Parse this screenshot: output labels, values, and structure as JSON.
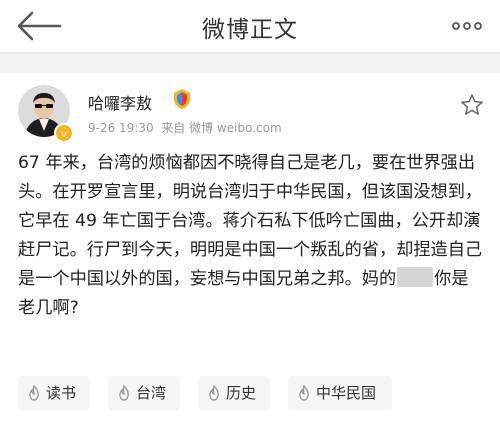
{
  "header": {
    "title": "微博正文",
    "back_icon": "back-arrow-icon",
    "more_icon": "more-dots-icon"
  },
  "post": {
    "username": "哈囉李敖",
    "time": "9-26 19:30",
    "source": "来自 微博 weibo.com",
    "content_before": "67 年来，台湾的烦恼都因不晓得自己是老几，要在世界强出头。在开罗宣言里，明说台湾归于中华民国，但该国没想到，它早在 49 年亡国于台湾。蒋介石私下低吟亡国曲，公开却演赶尸记。行尸到今天，明明是中国一个叛乱的省，却捏造自己是一个中国以外的国，妄想与中国兄弟之邦。妈的",
    "content_after": "你是老几啊?"
  },
  "tags": [
    {
      "label": "读书"
    },
    {
      "label": "台湾"
    },
    {
      "label": "历史"
    },
    {
      "label": "中华民国"
    }
  ],
  "colors": {
    "accent": "#f6b51e",
    "tag_bg": "#f5f5f5",
    "tag_icon": "#999999",
    "meta_text": "#999999"
  }
}
